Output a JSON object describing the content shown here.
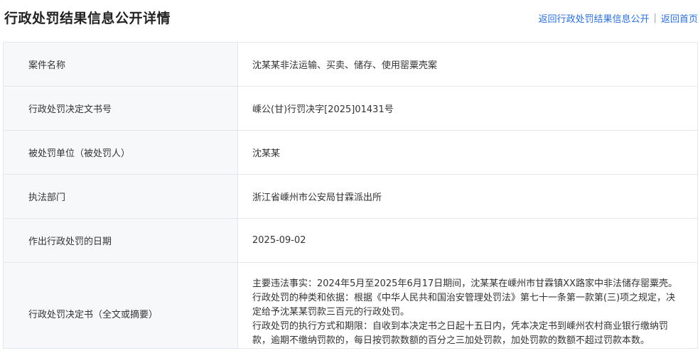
{
  "header": {
    "title": "行政处罚结果信息公开详情",
    "back_to_list": "返回行政处罚结果信息公开",
    "separator": "|",
    "back_to_home": "返回首页"
  },
  "rows": [
    {
      "key": "案件名称",
      "value": "沈某某非法运输、买卖、储存、使用罂粟壳案"
    },
    {
      "key": "行政处罚决定文书号",
      "value": "嵊公(甘)行罚决字[2025]01431号"
    },
    {
      "key": "被处罚单位（被处罚人）",
      "value": "沈某某"
    },
    {
      "key": "执法部门",
      "value": "浙江省嵊州市公安局甘霖派出所"
    },
    {
      "key": "作出行政处罚的日期",
      "value": "2025-09-02"
    }
  ],
  "decision": {
    "key": "行政处罚决定书（全文或摘要）",
    "facts": "主要违法事实：2024年5月至2025年6月17日期间，沈某某在嵊州市甘霖镇XX路家中非法储存罂粟壳。",
    "basis": "行政处罚的种类和依据：根据《中华人民共和国治安管理处罚法》第七十一条第一款第(三)项之规定，决定给予沈某某罚款三百元的行政处罚。",
    "execution": "行政处罚的执行方式和期限：自收到本决定书之日起十五日内，凭本决定书到嵊州农村商业银行缴纳罚款，逾期不缴纳罚款的，每日按罚款数额的百分之三加处罚款，加处罚款的数额不超过罚款本数。"
  }
}
